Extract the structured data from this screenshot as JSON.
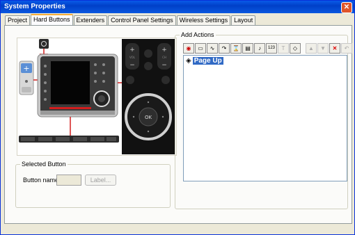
{
  "window": {
    "title": "System Properties",
    "close_glyph": "✕"
  },
  "tabs": [
    {
      "label": "Project"
    },
    {
      "label": "Hard Buttons",
      "active": true
    },
    {
      "label": "Extenders"
    },
    {
      "label": "Control Panel Settings"
    },
    {
      "label": "Wireless Settings"
    },
    {
      "label": "Layout"
    }
  ],
  "selected_button": {
    "group_label": "Selected Button",
    "button_name_label": "Button name:",
    "button_name_value": "",
    "label_button": "Label..."
  },
  "add_actions": {
    "group_label": "Add Actions",
    "toolbar_icons": [
      "ir-code-icon",
      "device-icon",
      "wave-icon",
      "jump-icon",
      "delay-icon",
      "page-icon",
      "sound-icon",
      "number-icon",
      "text-icon",
      "erase-icon",
      "move-up-icon",
      "move-down-icon",
      "delete-icon",
      "undo-icon"
    ],
    "actions": [
      {
        "label": "Page Up",
        "icon": "tag-icon"
      }
    ]
  },
  "remote": {
    "ok_label": "OK",
    "vol_label": "VOL",
    "ch_label": "CH"
  },
  "colors": {
    "title_bar": "#0a5ae8",
    "selection": "#316ac5",
    "window_bg": "#ece9d8",
    "connector": "#d21d1d"
  }
}
